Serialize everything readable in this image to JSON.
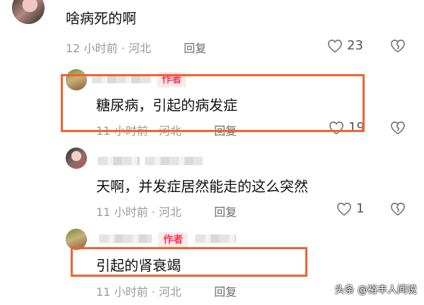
{
  "comments": [
    {
      "text": "啥病死的啊",
      "time_location": "12 小时前 · 河北",
      "reply_label": "回复",
      "likes": "23",
      "is_author": false
    },
    {
      "author_badge": "作者",
      "text": "糖尿病，引起的病发症",
      "time_location": "11 小时前 · 河北",
      "reply_label": "回复",
      "likes": "19",
      "is_author": true
    },
    {
      "text": "天啊，并发症居然能走的这么突然",
      "time_location": "11 小时前 · 河北",
      "reply_label": "回复",
      "likes": "1",
      "is_author": false
    },
    {
      "author_badge": "作者",
      "text": "引起的肾衰竭",
      "time_location": "11 小时前 · 河北",
      "reply_label": "回复",
      "likes": "",
      "is_author": true
    }
  ],
  "watermark": "头条 @裕丰人间说",
  "colors": {
    "highlight": "#f0632f",
    "author_badge_bg": "#ffe9ea",
    "author_badge_text": "#ff3050"
  },
  "icons": [
    "heart-icon",
    "broken-heart-icon"
  ]
}
